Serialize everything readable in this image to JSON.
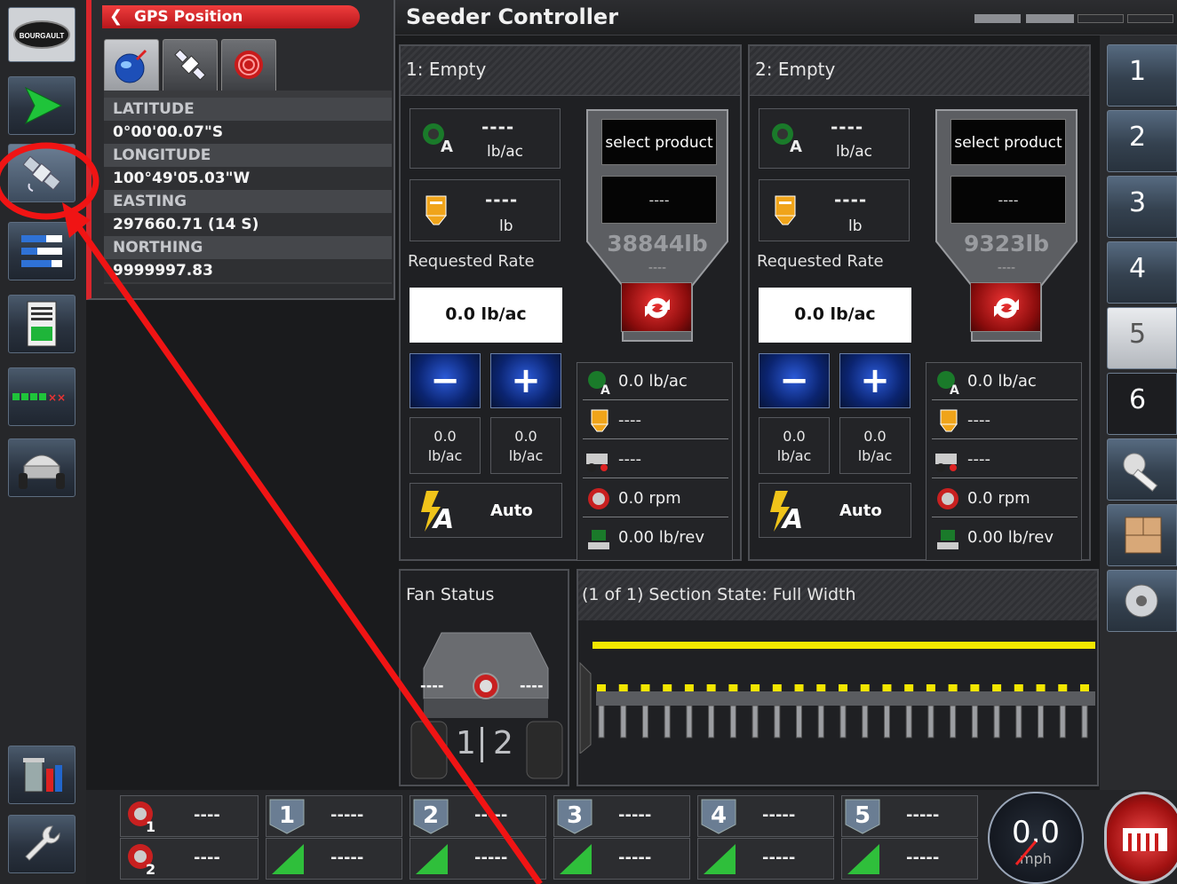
{
  "gps": {
    "header": "GPS Position",
    "rows": [
      {
        "label": "LATITUDE",
        "value": "0°00'00.07\"S"
      },
      {
        "label": "LONGITUDE",
        "value": "100°49'05.03\"W"
      },
      {
        "label": "EASTING",
        "value": "297660.71 (14 S)"
      },
      {
        "label": "NORTHING",
        "value": "9999997.83"
      }
    ]
  },
  "header": {
    "title": "Seeder Controller"
  },
  "products": [
    {
      "name": "1: Empty",
      "rate_value": "----",
      "rate_unit": "lb/ac",
      "qty_value": "----",
      "qty_unit": "lb",
      "requested_rate_label": "Requested Rate",
      "requested_rate": "0.0 lb/ac",
      "minus_value": "0.0",
      "minus_unit": "lb/ac",
      "plus_value": "0.0",
      "plus_unit": "lb/ac",
      "auto_label": "Auto",
      "select_product": "select product",
      "hopper_display": "----",
      "hopper_weight": "38844lb",
      "hopper_sub": "----",
      "info": [
        "0.0 lb/ac",
        "----",
        "----",
        "0.0 rpm",
        "0.00 lb/rev"
      ]
    },
    {
      "name": "2: Empty",
      "rate_value": "----",
      "rate_unit": "lb/ac",
      "qty_value": "----",
      "qty_unit": "lb",
      "requested_rate_label": "Requested Rate",
      "requested_rate": "0.0 lb/ac",
      "minus_value": "0.0",
      "minus_unit": "lb/ac",
      "plus_value": "0.0",
      "plus_unit": "lb/ac",
      "auto_label": "Auto",
      "select_product": "select product",
      "hopper_display": "----",
      "hopper_weight": "9323lb",
      "hopper_sub": "----",
      "info": [
        "0.0 lb/ac",
        "----",
        "----",
        "0.0 rpm",
        "0.00 lb/rev"
      ]
    }
  ],
  "fan": {
    "title": "Fan Status",
    "left_value": "----",
    "right_value": "----",
    "tank_1": "1",
    "tank_2": "2"
  },
  "section": {
    "title": "(1 of 1) Section State: Full Width"
  },
  "right_tabs": [
    "1",
    "2",
    "3",
    "4",
    "5",
    "6"
  ],
  "bottom": {
    "fan_rows": [
      {
        "badge": "1",
        "value": "----"
      },
      {
        "badge": "2",
        "value": "----"
      }
    ],
    "meters": [
      {
        "num": "1",
        "top": "-----",
        "bottom": "-----"
      },
      {
        "num": "2",
        "top": "-----",
        "bottom": "-----"
      },
      {
        "num": "3",
        "top": "-----",
        "bottom": "-----"
      },
      {
        "num": "4",
        "top": "-----",
        "bottom": "-----"
      },
      {
        "num": "5",
        "top": "-----",
        "bottom": "-----"
      }
    ],
    "speed_value": "0.0",
    "speed_unit": "mph"
  },
  "left_nav": {
    "logo_text": "BOURGAULT",
    "items": [
      "logo",
      "guidance",
      "gps-position",
      "section-bars",
      "seeder-report",
      "section-control",
      "seeder-implement",
      "data-transfer",
      "settings"
    ]
  },
  "colors": {
    "accent_red": "#d9262c",
    "section_yellow": "#f2e600",
    "meter_green": "#2fbf3b",
    "blue_button": "#1a44b8"
  }
}
